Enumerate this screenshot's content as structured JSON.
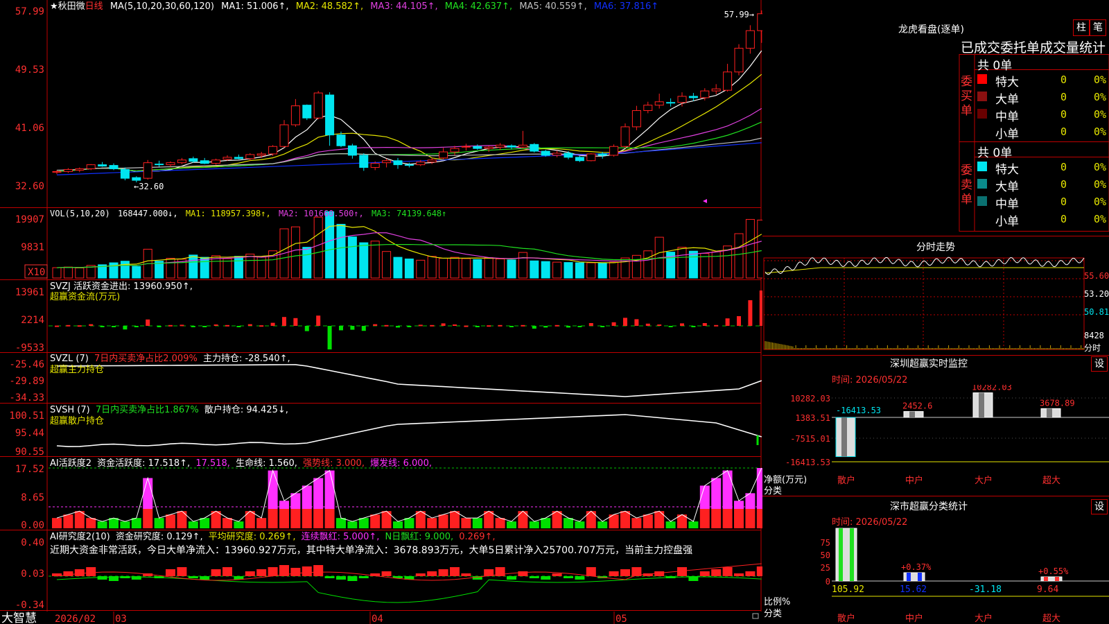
{
  "colors": {
    "up": "#ff2020",
    "down": "#00e5f0",
    "green": "#00e000",
    "grid": "#c00000",
    "ma1": "#ffffff",
    "ma2": "#e6e600",
    "ma3": "#e040e0",
    "ma4": "#20e020",
    "ma5": "#c0c0c0",
    "ma6": "#1030ff",
    "magenta": "#ff30ff",
    "label": "#ff3030"
  },
  "header": {
    "star": "★",
    "stock_name": "秋田微",
    "period": "日线",
    "ma_label": "MA(5,10,20,30,60,120)",
    "ma1": "MA1: 51.006↑,",
    "ma2": "MA2: 48.582↑,",
    "ma3": "MA3: 44.105↑,",
    "ma4": "MA4: 42.637↑,",
    "ma5": "MA5: 40.559↑,",
    "ma6": "MA6: 37.816↑"
  },
  "price_axis": [
    "57.99",
    "49.53",
    "41.06",
    "32.60"
  ],
  "annotations": {
    "high": "57.99",
    "low": "32.60"
  },
  "vol": {
    "label": "VOL(5,10,20)",
    "value": "168447.000↓,",
    "ma1": "MA1: 118957.398↑,",
    "ma2": "MA2: 101660.500↑,",
    "ma3": "MA3: 74139.648↑",
    "axis": [
      "19907",
      "9831"
    ],
    "unit": "X10"
  },
  "svzj": {
    "label": "SVZJ  活跃资金进出: 13960.950↑,",
    "sub": "超赢资金流(万元)",
    "axis": [
      "13961",
      "2214",
      "-9533"
    ]
  },
  "svzl": {
    "label": "SVZL (7)",
    "ratio": "7日内买卖净占比2.009%",
    "hold": "主力持仓: -28.540↑,",
    "sub": "超赢主力持仓",
    "axis": [
      "-25.46",
      "-29.89",
      "-34.33"
    ]
  },
  "svsh": {
    "label": "SVSH (7)",
    "ratio": "7日内买卖净占比1.867%",
    "hold": "散户持仓: 94.425↓,",
    "sub": "超赢散户持仓",
    "axis": [
      "100.51",
      "95.44",
      "90.55"
    ]
  },
  "ai_active": {
    "label": "AI活跃度2",
    "v1": "资金活跃度: 17.518↑,",
    "v2": "17.518,",
    "v3": "生命线: 1.560,",
    "v4": "强势线: 3.000,",
    "v5": "爆发线: 6.000,",
    "axis": [
      "17.52",
      "8.65",
      "0.00"
    ]
  },
  "ai_research": {
    "label": "AI研究度2(10)",
    "v1": "资金研究度: 0.129↑,",
    "v2": "平均研究度: 0.269↑,",
    "v3": "连续飘红: 5.000↑,",
    "v4": "N日飘红: 9.000,",
    "v5": "0.269↑,",
    "comment": "近期大资金非常活跃，今日大单净流入：13960.927万元，其中特大单净流入：3678.893万元，大单5日累计净入25700.707万元，当前主力控盘强",
    "axis": [
      "0.40",
      "0.03",
      "-0.34"
    ]
  },
  "bottom_bar": {
    "app": "大智慧",
    "dates": [
      "2026/02",
      "03",
      "04",
      "05"
    ]
  },
  "right": {
    "lhb_title": "龙虎看盘(逐单)",
    "tabs": [
      "柱",
      "笔"
    ],
    "stat_title": "已成交委托单成交量统计",
    "buy_side": {
      "side_label": "委买单",
      "total": "共 0单",
      "rows": [
        {
          "label": "特大",
          "count": "0",
          "pct": "0%",
          "color": "#ff0000"
        },
        {
          "label": "大单",
          "count": "0",
          "pct": "0%",
          "color": "#8b1010"
        },
        {
          "label": "中单",
          "count": "0",
          "pct": "0%",
          "color": "#6a0000"
        },
        {
          "label": "小单",
          "count": "0",
          "pct": "0%",
          "color": "#000000"
        }
      ]
    },
    "sell_side": {
      "side_label": "委卖单",
      "total": "共 0单",
      "rows": [
        {
          "label": "特大",
          "count": "0",
          "pct": "0%",
          "color": "#00e5f0"
        },
        {
          "label": "大单",
          "count": "0",
          "pct": "0%",
          "color": "#0a8a8a"
        },
        {
          "label": "中单",
          "count": "0",
          "pct": "0%",
          "color": "#0a7070"
        },
        {
          "label": "小单",
          "count": "0",
          "pct": "0%",
          "color": "#000000"
        }
      ]
    },
    "intraday": {
      "title": "分时走势",
      "axis": [
        "55.60",
        "53.20",
        "50.81",
        "8428",
        "分时"
      ]
    },
    "sz_monitor": {
      "title": "深圳超赢实时监控",
      "set": "设",
      "time": "时间: 2026/05/22",
      "axis": [
        "10282.03",
        "1383.51",
        "-7515.01",
        "-16413.53"
      ],
      "ylabel": "净额(万元)",
      "xlabel": "分类",
      "categories": [
        "散户",
        "中户",
        "大户",
        "超大"
      ],
      "values": [
        -16413.53,
        2452.6,
        10282.03,
        3678.89
      ],
      "labels": [
        "-16413.53",
        "2452.6",
        "10282.03",
        "3678.89"
      ]
    },
    "sz_class": {
      "title": "深市超赢分类统计",
      "set": "设",
      "time": "时间: 2026/05/22",
      "axis": [
        "75",
        "50",
        "25",
        "0"
      ],
      "ylabel": "比例%",
      "xlabel": "分类",
      "categories": [
        "散户",
        "中户",
        "大户",
        "超大"
      ],
      "values": [
        "105.92",
        "15.62",
        "-31.18",
        "9.64"
      ],
      "pct_labels": [
        "+0.37%",
        "+0.55%"
      ]
    }
  },
  "chart_data": [
    {
      "type": "candlestick",
      "title": "秋田微 日线",
      "ylim": [
        32.6,
        57.99
      ],
      "ohlc": [
        [
          34.1,
          34.4,
          33.8,
          34.2
        ],
        [
          34.2,
          34.7,
          34.0,
          34.5
        ],
        [
          34.4,
          34.8,
          34.1,
          34.6
        ],
        [
          34.6,
          35.3,
          34.4,
          35.2
        ],
        [
          35.2,
          35.6,
          34.9,
          35.0
        ],
        [
          35.1,
          35.4,
          34.4,
          34.6
        ],
        [
          34.5,
          34.8,
          32.9,
          33.2
        ],
        [
          33.3,
          33.5,
          32.6,
          32.9
        ],
        [
          33.2,
          35.9,
          33.0,
          35.5
        ],
        [
          35.3,
          35.8,
          34.9,
          35.2
        ],
        [
          35.2,
          35.7,
          34.9,
          35.5
        ],
        [
          35.5,
          36.2,
          35.3,
          35.9
        ],
        [
          36.1,
          36.4,
          35.5,
          35.7
        ],
        [
          35.8,
          36.2,
          35.3,
          35.4
        ],
        [
          35.4,
          36.1,
          35.2,
          35.9
        ],
        [
          36.0,
          36.6,
          35.8,
          36.3
        ],
        [
          36.3,
          36.7,
          36.0,
          36.1
        ],
        [
          36.1,
          36.9,
          35.8,
          36.7
        ],
        [
          36.6,
          37.1,
          36.2,
          36.8
        ],
        [
          36.8,
          38.1,
          36.5,
          37.9
        ],
        [
          37.9,
          41.8,
          37.7,
          41.1
        ],
        [
          41.1,
          44.9,
          40.8,
          43.9
        ],
        [
          44.0,
          44.1,
          41.8,
          42.1
        ],
        [
          42.1,
          46.1,
          41.9,
          45.8
        ],
        [
          45.5,
          45.9,
          38.0,
          39.6
        ],
        [
          39.6,
          40.1,
          37.8,
          38.0
        ],
        [
          38.0,
          38.3,
          36.1,
          36.6
        ],
        [
          36.6,
          36.9,
          34.3,
          34.8
        ],
        [
          34.8,
          35.7,
          34.4,
          35.4
        ],
        [
          35.5,
          36.1,
          34.8,
          35.8
        ],
        [
          35.8,
          36.2,
          34.6,
          35.2
        ],
        [
          35.2,
          35.5,
          34.8,
          35.1
        ],
        [
          35.2,
          35.9,
          35.0,
          35.6
        ],
        [
          35.6,
          36.2,
          35.3,
          35.9
        ],
        [
          36.2,
          37.7,
          36.0,
          37.1
        ],
        [
          37.1,
          38.0,
          36.6,
          37.6
        ],
        [
          37.8,
          38.3,
          37.3,
          37.9
        ],
        [
          37.9,
          38.2,
          37.4,
          37.6
        ],
        [
          37.6,
          38.0,
          37.1,
          37.8
        ],
        [
          37.8,
          38.4,
          37.4,
          38.1
        ],
        [
          38.0,
          38.2,
          37.5,
          37.8
        ],
        [
          37.8,
          40.2,
          37.6,
          38.1
        ],
        [
          38.2,
          38.4,
          37.0,
          37.2
        ],
        [
          37.2,
          37.4,
          36.4,
          36.6
        ],
        [
          36.6,
          37.3,
          36.3,
          36.9
        ],
        [
          36.9,
          37.2,
          36.0,
          36.3
        ],
        [
          36.3,
          36.5,
          35.6,
          35.8
        ],
        [
          35.8,
          36.9,
          35.7,
          36.8
        ],
        [
          36.8,
          37.1,
          36.1,
          36.6
        ],
        [
          36.6,
          38.2,
          36.4,
          37.9
        ],
        [
          37.9,
          41.3,
          37.6,
          40.8
        ],
        [
          40.8,
          43.9,
          40.3,
          43.2
        ],
        [
          43.2,
          44.5,
          42.8,
          44.0
        ],
        [
          44.0,
          45.7,
          43.5,
          44.5
        ],
        [
          44.4,
          45.0,
          43.8,
          44.3
        ],
        [
          44.4,
          45.9,
          43.8,
          45.3
        ],
        [
          45.3,
          45.8,
          44.6,
          45.1
        ],
        [
          45.1,
          46.5,
          44.7,
          46.1
        ],
        [
          46.1,
          47.1,
          45.6,
          46.4
        ],
        [
          46.2,
          50.1,
          46.0,
          48.9
        ],
        [
          48.9,
          53.0,
          48.4,
          52.4
        ],
        [
          52.4,
          55.8,
          51.6,
          55.0
        ],
        [
          55.0,
          57.99,
          53.2,
          57.5
        ]
      ],
      "ma": {
        "MA1": 51.006,
        "MA2": 48.582,
        "MA3": 44.105,
        "MA4": 42.637,
        "MA5": 40.559,
        "MA6": 37.816
      }
    },
    {
      "type": "bar",
      "title": "VOL(5,10,20)",
      "ylim": [
        0,
        19907
      ],
      "values": [
        3200,
        3400,
        3100,
        3900,
        4100,
        4700,
        5200,
        3600,
        8900,
        5200,
        6100,
        5800,
        7100,
        6400,
        6900,
        6000,
        6700,
        7400,
        6500,
        8400,
        15200,
        15800,
        9500,
        18800,
        20500,
        16600,
        12700,
        10900,
        11400,
        8200,
        6400,
        5900,
        5500,
        6700,
        6100,
        6400,
        6000,
        5700,
        6300,
        5900,
        5600,
        7900,
        5300,
        5100,
        4900,
        4800,
        4700,
        4700,
        4600,
        4900,
        6200,
        7000,
        8400,
        12600,
        8000,
        9500,
        8300,
        7600,
        8100,
        9900,
        13700,
        18100,
        17900
      ]
    },
    {
      "type": "bar",
      "title": "超赢资金流(万元)",
      "ylim": [
        -9533,
        13961
      ]
    },
    {
      "type": "line",
      "title": "超赢主力持仓",
      "ylim": [
        -34.33,
        -25.46
      ]
    },
    {
      "type": "line",
      "title": "超赢散户持仓",
      "ylim": [
        90.55,
        100.51
      ]
    },
    {
      "type": "bar",
      "title": "AI活跃度2",
      "ylim": [
        0,
        17.52
      ]
    },
    {
      "type": "bar",
      "title": "AI研究度2(10)",
      "ylim": [
        -0.34,
        0.4
      ]
    }
  ]
}
